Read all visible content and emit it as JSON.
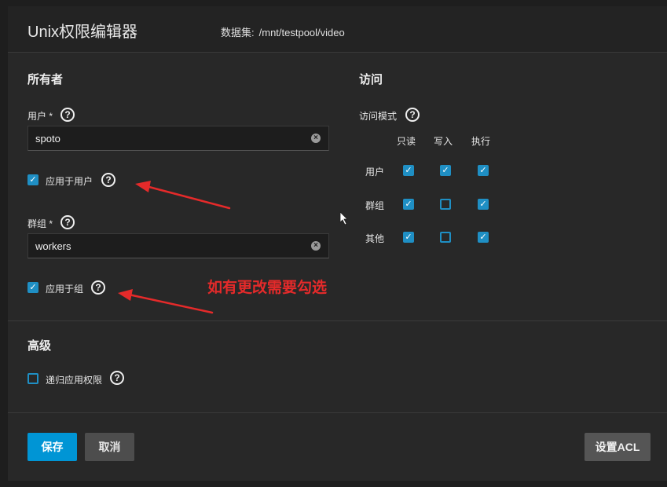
{
  "header": {
    "title": "Unix权限编辑器",
    "dataset_label": "数据集:",
    "dataset_path": "/mnt/testpool/video"
  },
  "owner": {
    "section_title": "所有者",
    "user_label": "用户 *",
    "user_value": "spoto",
    "apply_user_label": "应用于用户",
    "apply_user_checked": true,
    "group_label": "群组 *",
    "group_value": "workers",
    "apply_group_label": "应用于组",
    "apply_group_checked": true
  },
  "access": {
    "section_title": "访问",
    "mode_label": "访问模式",
    "columns": [
      "只读",
      "写入",
      "执行"
    ],
    "rows": [
      {
        "label": "用户",
        "values": [
          true,
          true,
          true
        ]
      },
      {
        "label": "群组",
        "values": [
          true,
          false,
          true
        ]
      },
      {
        "label": "其他",
        "values": [
          true,
          false,
          true
        ]
      }
    ]
  },
  "advanced": {
    "section_title": "高级",
    "recursive_label": "递归应用权限",
    "recursive_checked": false
  },
  "buttons": {
    "save": "保存",
    "cancel": "取消",
    "set_acl": "设置ACL"
  },
  "annotation": {
    "text": "如有更改需要勾选",
    "color": "#e52a2a"
  },
  "colors": {
    "accent": "#0095d5",
    "checkbox": "#1f8fc4"
  }
}
